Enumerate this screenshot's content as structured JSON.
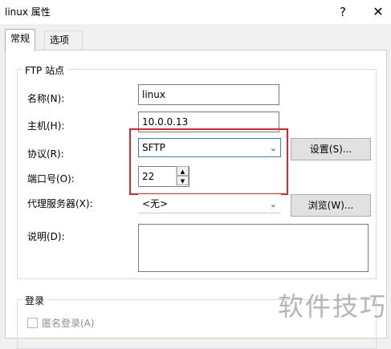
{
  "window": {
    "title": "linux 属性",
    "help_glyph": "?",
    "close_glyph": "✕"
  },
  "tabs": [
    {
      "label": "常规",
      "active": true
    },
    {
      "label": "选项",
      "active": false
    }
  ],
  "ftp_group": {
    "title": "FTP 站点",
    "name_label": "名称(N):",
    "name_value": "linux",
    "host_label": "主机(H):",
    "host_value": "10.0.0.13",
    "protocol_label": "协议(R):",
    "protocol_value": "SFTP",
    "settings_button": "设置(S)...",
    "port_label": "端口号(O):",
    "port_value": "22",
    "proxy_label": "代理服务器(X):",
    "proxy_value": "<无>",
    "browse_button": "浏览(W)...",
    "desc_label": "说明(D):",
    "desc_value": ""
  },
  "login_group": {
    "title": "登录",
    "anonymous_label": "匿名登录(A)"
  },
  "watermark": "软件技巧",
  "colors": {
    "highlight_box": "#d9262b",
    "focus_border": "#3c7fb1"
  }
}
